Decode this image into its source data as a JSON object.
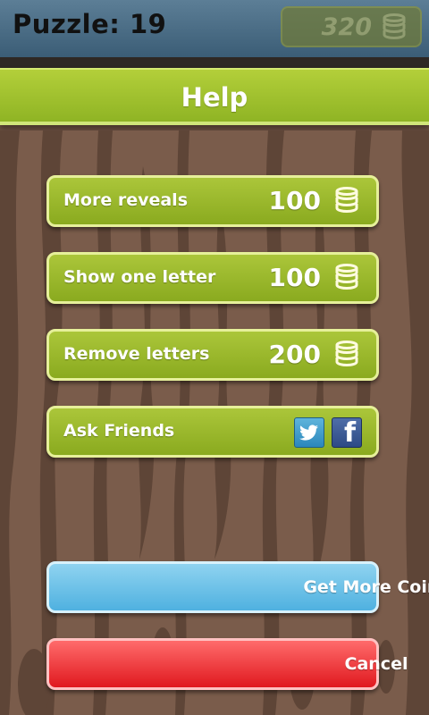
{
  "header": {
    "puzzle_label": "Puzzle: 19",
    "coins": "320"
  },
  "help": {
    "title": "Help"
  },
  "options": [
    {
      "label": "More reveals",
      "price": "100",
      "icon": "coin-stack-icon"
    },
    {
      "label": "Show one letter",
      "price": "100",
      "icon": "coin-stack-icon"
    },
    {
      "label": "Remove letters",
      "price": "200",
      "icon": "coin-stack-icon"
    },
    {
      "label": "Ask Friends",
      "icons": [
        "twitter-icon",
        "facebook-icon"
      ]
    }
  ],
  "buttons": {
    "get_more_coins": "Get More Coins",
    "cancel": "Cancel"
  },
  "colors": {
    "green_button": "#9ab92c",
    "blue_button": "#6ec3ea",
    "red_button": "#f0363a",
    "wood": "#6b5041"
  }
}
